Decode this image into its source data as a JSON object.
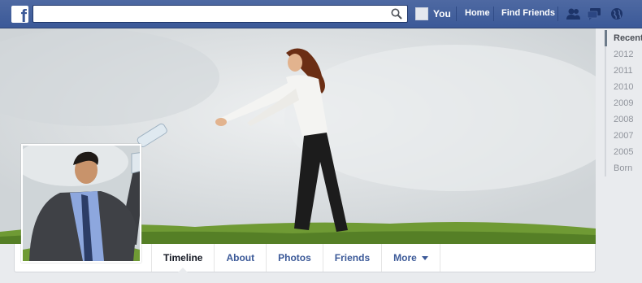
{
  "topbar": {
    "logo_letter": "f",
    "search": {
      "value": "",
      "placeholder": ""
    },
    "user_label": "You",
    "nav": [
      "Home",
      "Find Friends"
    ]
  },
  "profile_tabs": [
    {
      "label": "Timeline",
      "active": true
    },
    {
      "label": "About",
      "active": false
    },
    {
      "label": "Photos",
      "active": false
    },
    {
      "label": "Friends",
      "active": false
    },
    {
      "label": "More",
      "active": false,
      "dropdown": true
    }
  ],
  "timeline_years": [
    {
      "label": "Recent",
      "active": true
    },
    {
      "label": "2012",
      "active": false
    },
    {
      "label": "2011",
      "active": false
    },
    {
      "label": "2010",
      "active": false
    },
    {
      "label": "2009",
      "active": false
    },
    {
      "label": "2008",
      "active": false
    },
    {
      "label": "2007",
      "active": false
    },
    {
      "label": "2005",
      "active": false
    },
    {
      "label": "Born",
      "active": false
    }
  ],
  "colors": {
    "brand_blue": "#3b5998",
    "page_bg": "#e9ebee",
    "grass": "#5e8a2c"
  }
}
